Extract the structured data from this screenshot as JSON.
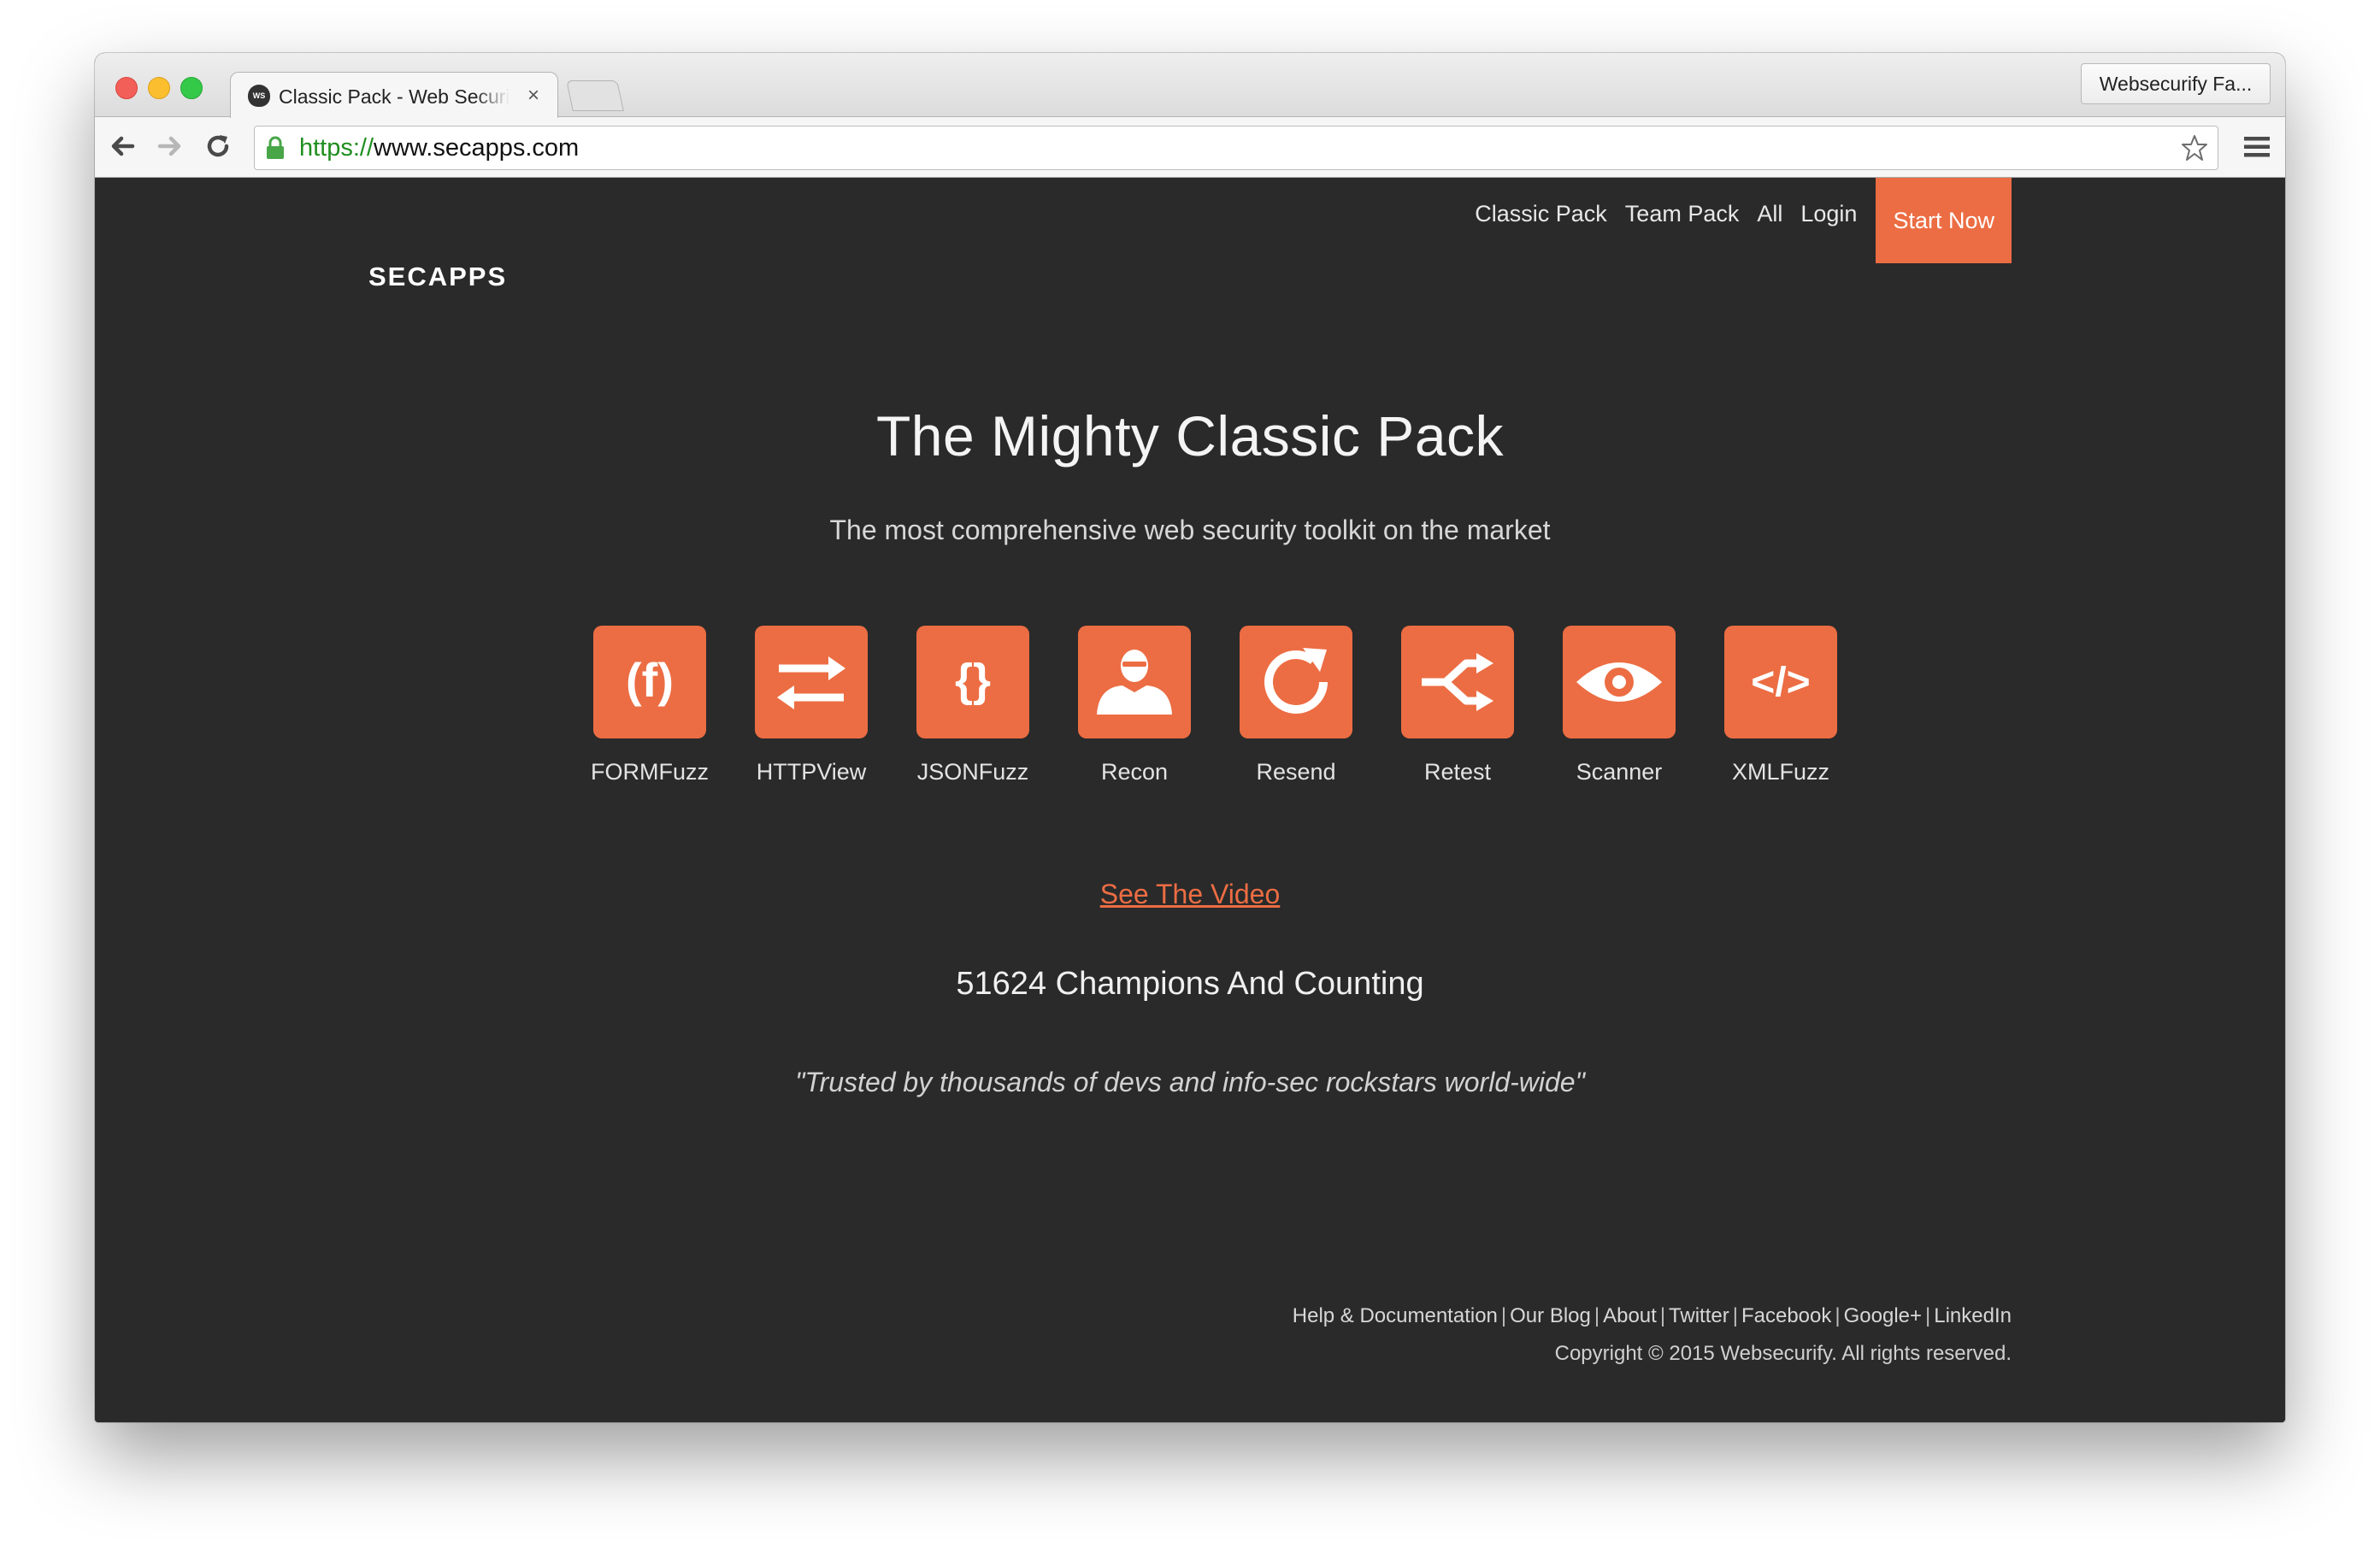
{
  "browser": {
    "tab_title": "Classic Pack - Web Security Tools",
    "favicon_text": "WS",
    "profile_label": "Websecurify Fa...",
    "url_scheme": "https://",
    "url_host": "www.secapps.com"
  },
  "site": {
    "logo": "SECAPPS",
    "nav": [
      "Classic Pack",
      "Team Pack",
      "All",
      "Login"
    ],
    "cta": "Start Now",
    "accent_color": "#ec6d43",
    "background_color": "#2a2a2a"
  },
  "hero": {
    "title": "The Mighty Classic Pack",
    "subtitle": "The most comprehensive web security toolkit on the market"
  },
  "tools": [
    {
      "label": "FORMFuzz",
      "icon": "form-fuzz-icon"
    },
    {
      "label": "HTTPView",
      "icon": "arrows-exchange-icon"
    },
    {
      "label": "JSONFuzz",
      "icon": "curly-braces-icon"
    },
    {
      "label": "Recon",
      "icon": "user-agent-icon"
    },
    {
      "label": "Resend",
      "icon": "refresh-icon"
    },
    {
      "label": "Retest",
      "icon": "shuffle-icon"
    },
    {
      "label": "Scanner",
      "icon": "eye-icon"
    },
    {
      "label": "XMLFuzz",
      "icon": "code-tag-icon"
    }
  ],
  "video_link": "See The Video",
  "counter": "51624 Champions And Counting",
  "quote": "\"Trusted by thousands of devs and info-sec rockstars world-wide\"",
  "footer": {
    "links": [
      "Help & Documentation",
      "Our Blog",
      "About",
      "Twitter",
      "Facebook",
      "Google+",
      "LinkedIn"
    ],
    "copyright": "Copyright © 2015 Websecurify. All rights reserved."
  }
}
